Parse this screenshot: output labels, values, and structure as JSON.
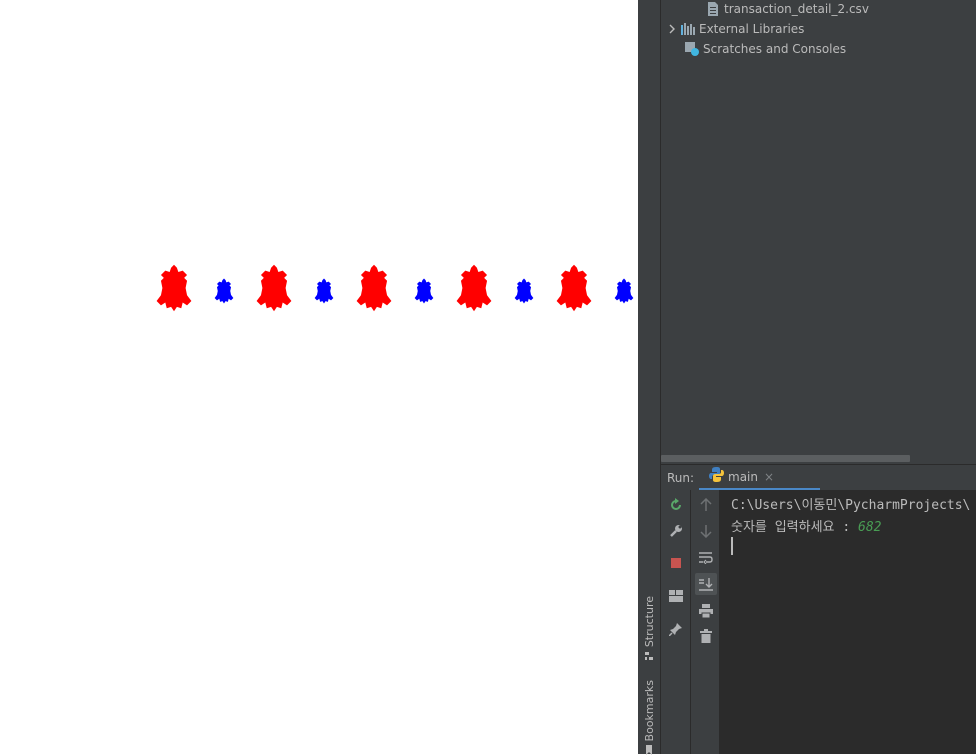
{
  "project_tree": {
    "items": [
      {
        "label": "transaction_detail_2.csv",
        "icon": "csv-file-icon"
      },
      {
        "label": "External Libraries",
        "icon": "libraries-icon",
        "expandable": true
      },
      {
        "label": "Scratches and Consoles",
        "icon": "scratches-icon"
      }
    ]
  },
  "tool_stripe": {
    "structure_label": "Structure",
    "bookmarks_label": "Bookmarks"
  },
  "run_panel": {
    "label": "Run:",
    "tab_label": "main",
    "tab_close": "×",
    "console_lines": [
      "C:\\Users\\이동민\\PycharmProjects\\",
      "숫자를 입력하세요 : "
    ],
    "console_input": "682"
  },
  "turtle_canvas": {
    "large_turtle_color": "#ff0000",
    "small_turtle_color": "#0000ff",
    "turtle_pattern": [
      "large",
      "small",
      "large",
      "small",
      "large",
      "small",
      "large",
      "small",
      "large",
      "small"
    ]
  },
  "colors": {
    "ide_background": "#3c3f41",
    "console_background": "#2b2b2b",
    "run_tab_accent": "#4a88c7",
    "stop_button": "#c75450",
    "rerun_button": "#59a869"
  }
}
